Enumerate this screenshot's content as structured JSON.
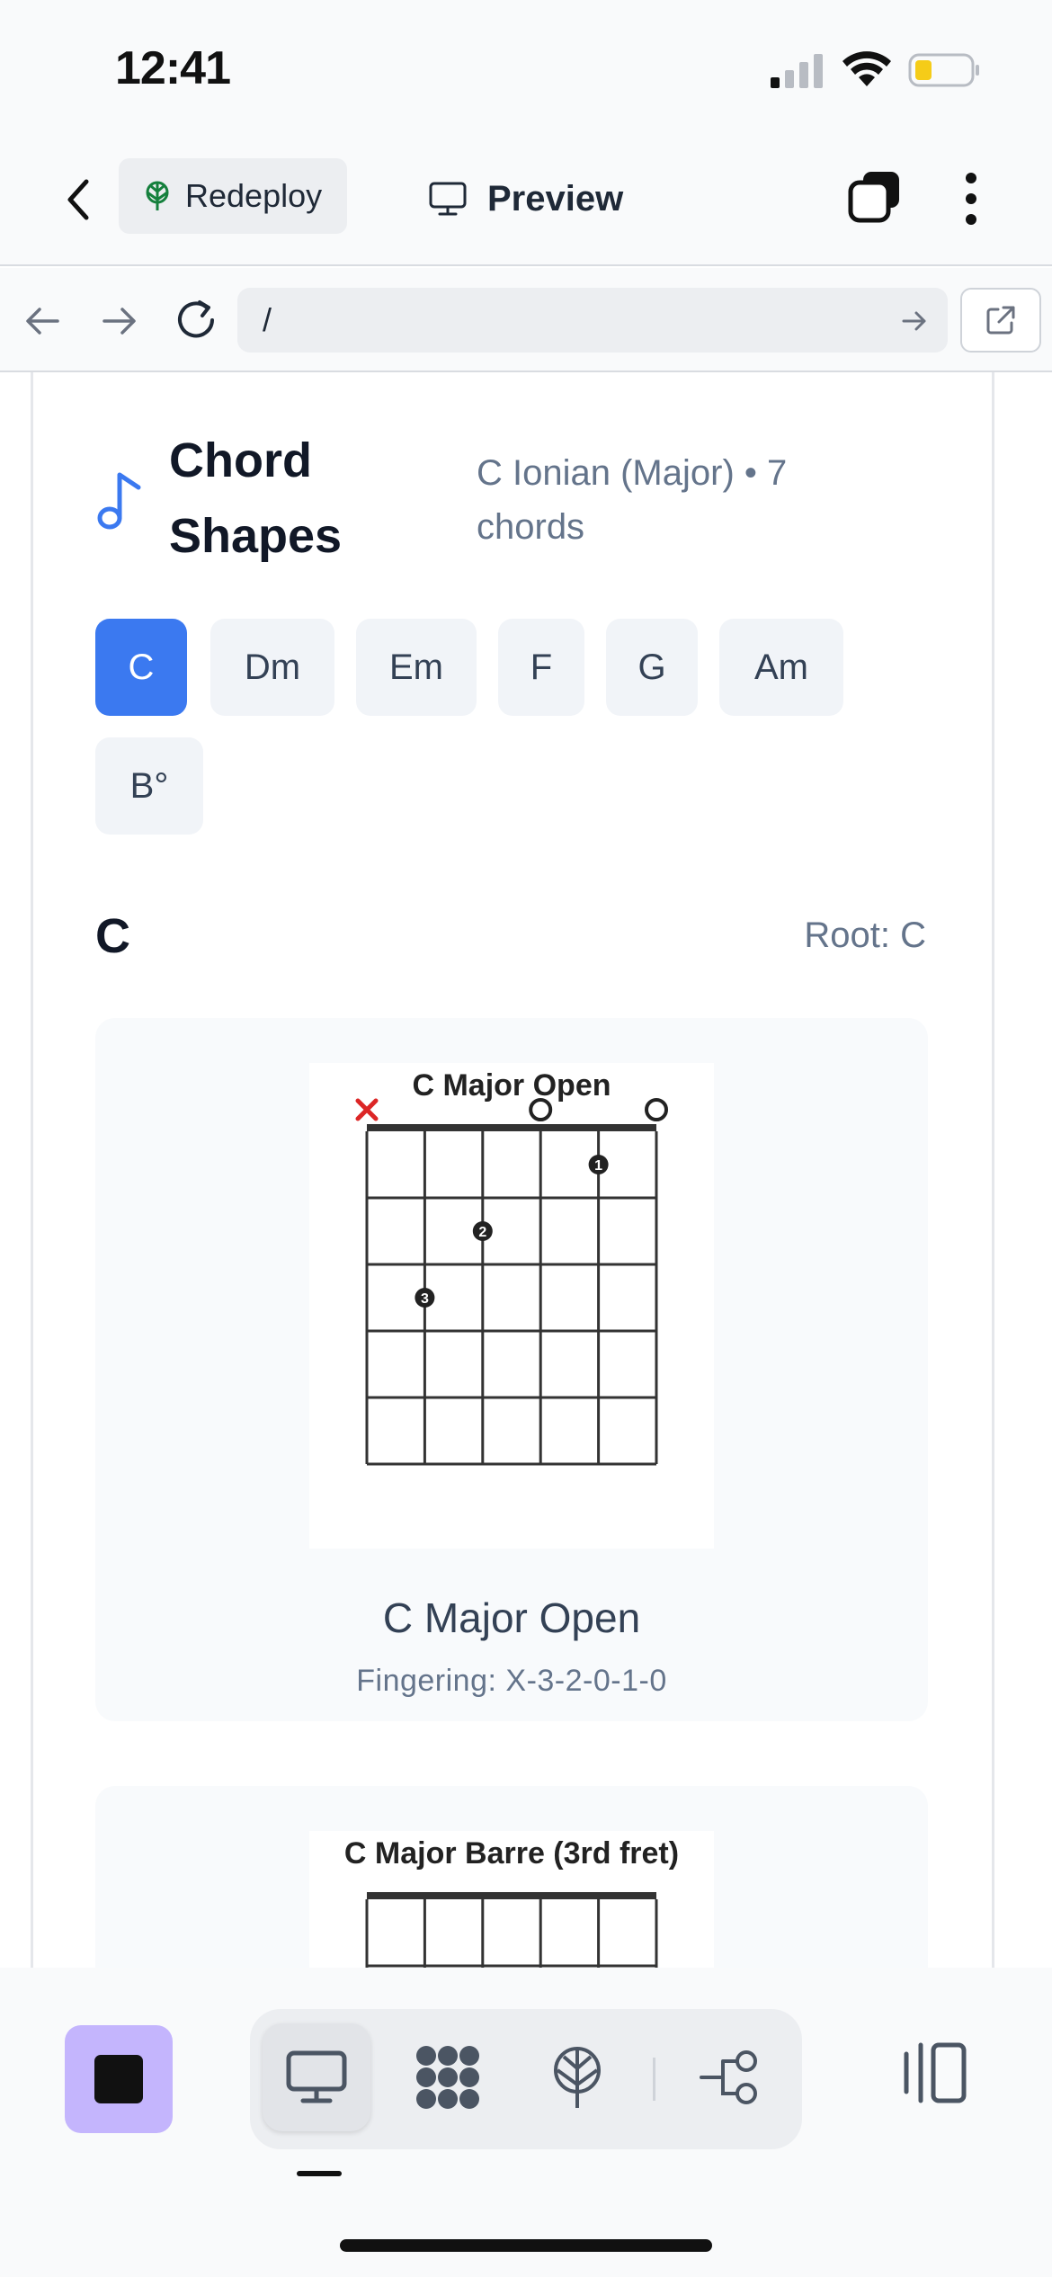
{
  "status_bar": {
    "time": "12:41"
  },
  "toolbar": {
    "redeploy_label": "Redeploy",
    "preview_label": "Preview"
  },
  "browser": {
    "url": "/"
  },
  "section": {
    "title": "Chord Shapes",
    "subtitle": "C Ionian (Major) • 7 chords"
  },
  "chords": [
    "C",
    "Dm",
    "Em",
    "F",
    "G",
    "Am",
    "B°"
  ],
  "selected_chord": {
    "name": "C",
    "active_index": 0,
    "root_label": "Root: C"
  },
  "shapes": [
    {
      "diagram_title": "C Major Open",
      "name": "C Major Open",
      "fingering": "Fingering: X-3-2-0-1-0",
      "frets": [
        "x",
        3,
        2,
        0,
        1,
        0
      ],
      "fingers": [
        null,
        3,
        2,
        null,
        1,
        null
      ],
      "marker_colors": {
        "muted": "#dc2626",
        "open": "#222222",
        "dot": "#222222"
      }
    },
    {
      "diagram_title": "C Major Barre (3rd fret)"
    }
  ],
  "bottom_bar": {
    "icons": [
      "stop-icon",
      "desktop-icon",
      "network-icon",
      "deploy-icon",
      "flow-icon",
      "split-view-icon"
    ],
    "accent": "#c4b5fd"
  },
  "colors": {
    "primary": "#3b79f0",
    "chip_bg": "#f1f4f8",
    "muted_text": "#64748b"
  }
}
